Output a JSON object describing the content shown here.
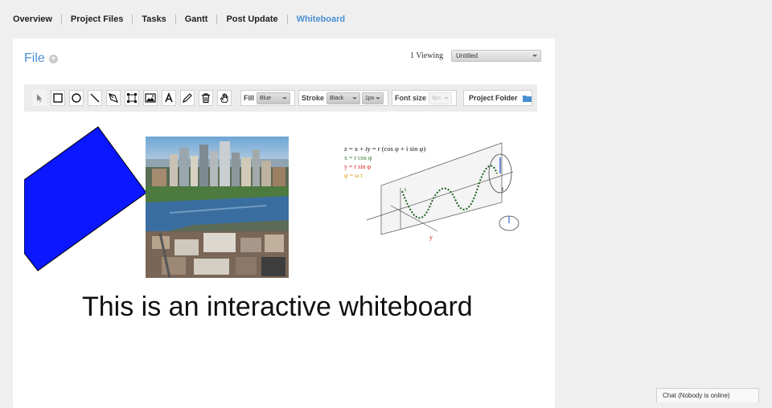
{
  "nav": {
    "items": [
      {
        "label": "Overview"
      },
      {
        "label": "Project Files"
      },
      {
        "label": "Tasks"
      },
      {
        "label": "Gantt"
      },
      {
        "label": "Post Update"
      },
      {
        "label": "Whiteboard"
      }
    ],
    "active": "Whiteboard",
    "active_color": "#4a8fd1"
  },
  "file": {
    "title": "File",
    "plus": "+",
    "viewing": "1 Viewing",
    "document": "Untitled"
  },
  "toolbar": {
    "tools": [
      "pointer-icon",
      "rectangle-icon",
      "circle-icon",
      "line-icon",
      "pen-icon",
      "transform-icon",
      "image-icon",
      "text-icon",
      "pencil-icon",
      "trash-icon",
      "hand-icon"
    ],
    "fill_label": "Fill",
    "fill_value": "Blue",
    "stroke_label": "Stroke",
    "stroke_value": "Black",
    "stroke_width": "1px",
    "font_size_label": "Font size",
    "font_size_value": "8px",
    "folder_label": "Project Folder",
    "folder_icon": "folder-icon"
  },
  "canvas": {
    "shape_color": "#0a17ff",
    "text": "This is an interactive whiteboard",
    "formulas": [
      "z = x + iy = r (cos φ + i sin φ)",
      "x = r cos φ",
      "y = r sin φ",
      "φ = ω t"
    ],
    "axis_labels": {
      "x": "x",
      "y": "y",
      "t": "t"
    }
  },
  "chat": {
    "label": "Chat (Nobody is online)"
  }
}
